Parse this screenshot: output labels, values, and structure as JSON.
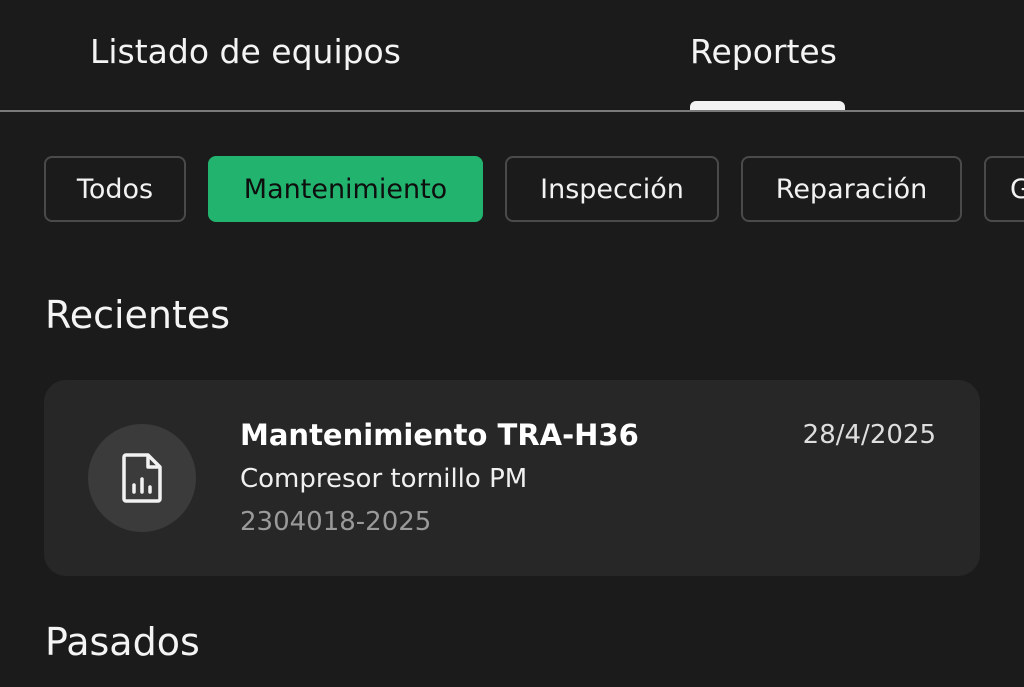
{
  "tabs": [
    {
      "label": "Listado de equipos",
      "active": false
    },
    {
      "label": "Reportes",
      "active": true
    }
  ],
  "filters": [
    {
      "label": "Todos",
      "active": false
    },
    {
      "label": "Mantenimiento",
      "active": true
    },
    {
      "label": "Inspección",
      "active": false
    },
    {
      "label": "Reparación",
      "active": false
    },
    {
      "label": "G",
      "active": false
    }
  ],
  "sections": {
    "recent_title": "Recientes",
    "past_title": "Pasados"
  },
  "recent_reports": [
    {
      "title": "Mantenimiento TRA-H36",
      "subtitle": "Compresor tornillo PM",
      "code": "2304018-2025",
      "date": "28/4/2025",
      "icon": "report-document-icon"
    }
  ],
  "colors": {
    "background": "#1b1b1b",
    "card": "#272727",
    "accent": "#22b46e"
  }
}
